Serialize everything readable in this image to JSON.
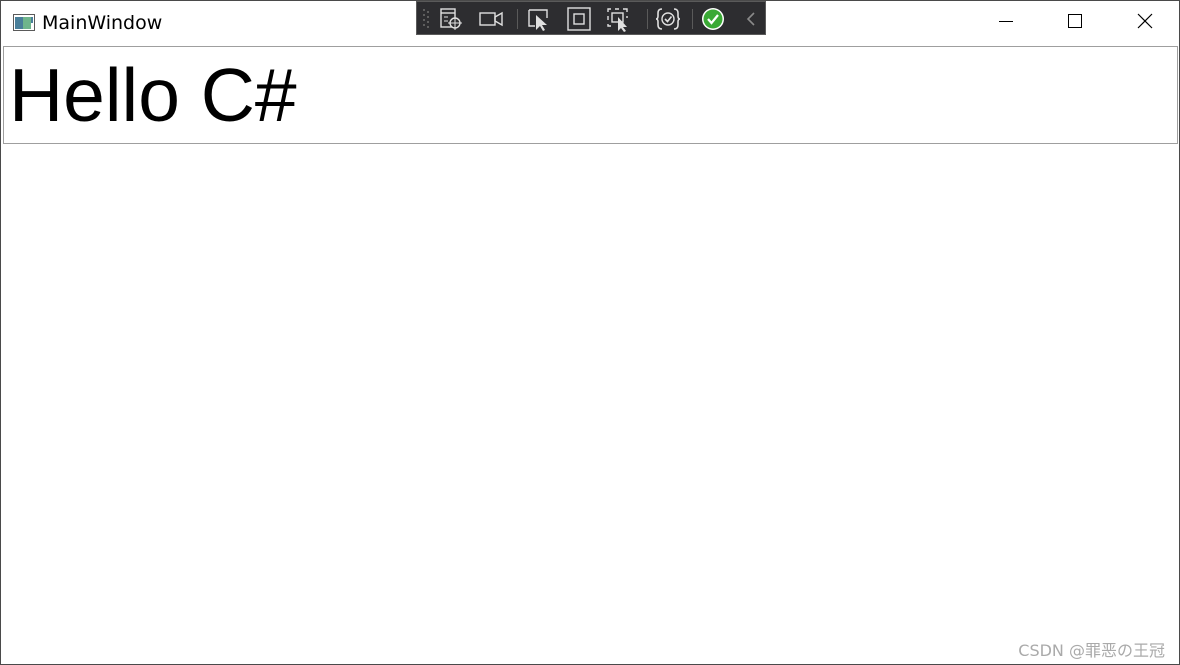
{
  "window": {
    "title": "MainWindow",
    "icons": {
      "app": "wpf-window-icon",
      "minimize": "minimize-icon",
      "maximize": "maximize-icon",
      "close": "close-icon"
    }
  },
  "debug_toolbar": {
    "items": [
      {
        "icon": "grip-icon"
      },
      {
        "icon": "go-to-live-visual-tree-icon"
      },
      {
        "icon": "record-video-icon"
      },
      {
        "icon": "select-element-icon"
      },
      {
        "icon": "display-layout-adorners-icon"
      },
      {
        "icon": "track-focused-element-icon"
      },
      {
        "icon": "binding-failures-icon"
      },
      {
        "icon": "no-issues-checkmark-icon"
      },
      {
        "icon": "collapse-toolbar-chevron-icon"
      }
    ],
    "colors": {
      "background": "#2d2d30",
      "check": "#3aa935"
    }
  },
  "content": {
    "textbox_text": "Hello C#"
  },
  "watermark": {
    "text": "CSDN @罪恶の王冠"
  }
}
